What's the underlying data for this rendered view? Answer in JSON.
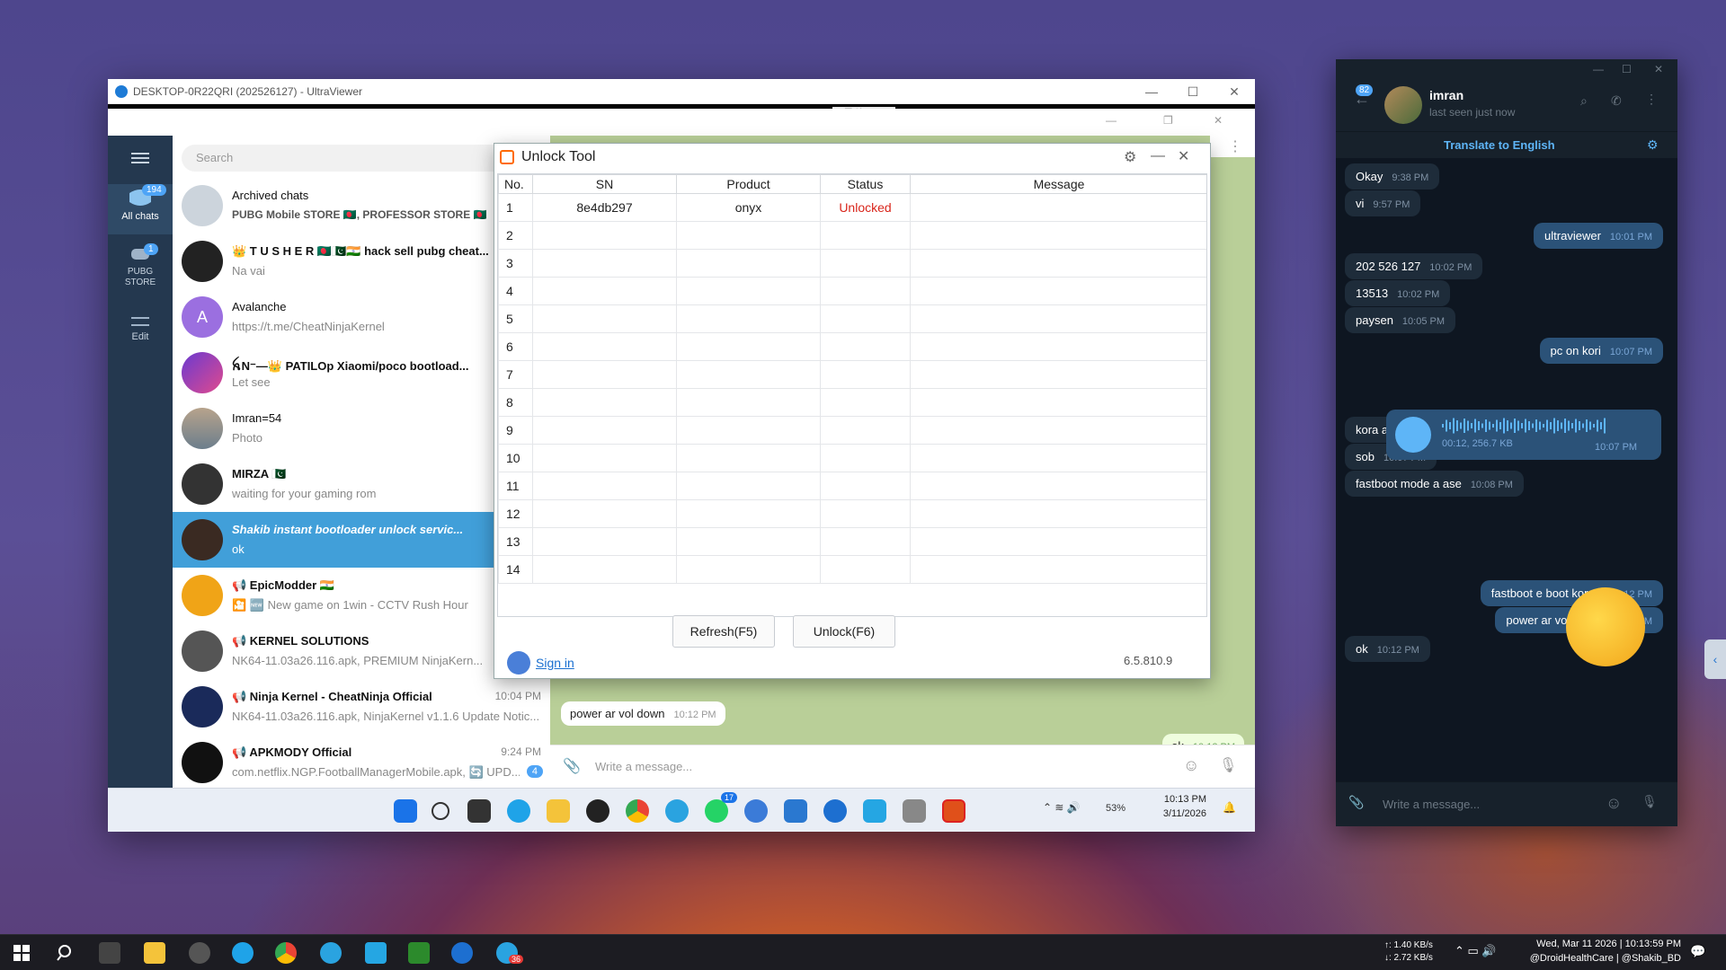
{
  "ultraviewer": {
    "title": "DESKTOP-0R22QRI (202526127) - UltraViewer"
  },
  "telegram_left": {
    "search_placeholder": "Search",
    "rail": [
      {
        "label": "All chats",
        "badge": "194"
      },
      {
        "label": "PUBG STORE",
        "badge": "1"
      },
      {
        "label": "Edit"
      }
    ],
    "chats": [
      {
        "name": "Archived chats",
        "preview": "PUBG Mobile STORE 🇧🇩, PROFESSOR STORE 🇧🇩",
        "time": ""
      },
      {
        "name": "👑 T U S H E R 🇧🇩🇵🇰🇮🇳 hack sell pubg cheat...",
        "preview": "Na vai",
        "time": ""
      },
      {
        "name": "Avalanche",
        "preview": "https://t.me/CheatNinjaKernel",
        "time": ""
      },
      {
        "name": "ꫝN⁻—👑 PATILOp Xiaomi/poco bootload...",
        "preview": "Let see",
        "time": ""
      },
      {
        "name": "Imran=54",
        "preview": "Photo",
        "time": ""
      },
      {
        "name": "MIRZA 🇵🇰",
        "preview": "waiting for your gaming rom",
        "time": ""
      },
      {
        "name": "Shakib instant bootloader unlock servic...",
        "preview": "ok",
        "time": ""
      },
      {
        "name": "📢 EpicModder 🇮🇳",
        "preview": "🎦 🆕 New game on 1win - CCTV Rush Hour",
        "time": ""
      },
      {
        "name": "📢 KERNEL SOLUTIONS",
        "preview": "NK64-11.03a26.116.apk, PREMIUM NinjaKern...",
        "time": ""
      },
      {
        "name": "📢 Ninja Kernel - CheatNinja Official",
        "preview": "NK64-11.03a26.116.apk, NinjaKernel v1.1.6 Update Notic...",
        "time": "10:04 PM"
      },
      {
        "name": "📢 APKMODY Official",
        "preview": "com.netflix.NGP.FootballManagerMobile.apk, 🔄 UPD...",
        "time": "9:24 PM",
        "badge": "4"
      }
    ],
    "chat_msgs": [
      {
        "text": "power ar vol down",
        "time": "10:12 PM"
      },
      {
        "text": "ok",
        "time": "10:12 PM"
      }
    ],
    "composer_placeholder": "Write a message..."
  },
  "unlock_tool": {
    "title": "Unlock Tool",
    "columns": [
      "No.",
      "SN",
      "Product",
      "Status",
      "Message"
    ],
    "rows": [
      {
        "no": "1",
        "sn": "8e4db297",
        "product": "onyx",
        "status": "Unlocked",
        "message": ""
      },
      {
        "no": "2"
      },
      {
        "no": "3"
      },
      {
        "no": "4"
      },
      {
        "no": "5"
      },
      {
        "no": "6"
      },
      {
        "no": "7"
      },
      {
        "no": "8"
      },
      {
        "no": "9"
      },
      {
        "no": "10"
      },
      {
        "no": "11"
      },
      {
        "no": "12"
      },
      {
        "no": "13"
      },
      {
        "no": "14"
      }
    ],
    "refresh_label": "Refresh(F5)",
    "unlock_label": "Unlock(F6)",
    "sign_in_label": "Sign in",
    "version": "6.5.810.9",
    "status_color": "#d9261c"
  },
  "remote_taskbar": {
    "time": "10:13 PM",
    "date": "3/11/2026",
    "battery": "53%",
    "badge_a": "17"
  },
  "telegram_right": {
    "back_badge": "82",
    "contact_name": "imran",
    "contact_status": "last seen just now",
    "translate_label": "Translate to English",
    "voice": {
      "meta": "00:12, 256.7 KB",
      "time": "10:07 PM",
      "progress": 0.0
    },
    "messages": [
      {
        "dir": "in",
        "text": "Okay",
        "time": "9:38 PM"
      },
      {
        "dir": "in",
        "text": "vi",
        "time": "9:57 PM"
      },
      {
        "dir": "out",
        "text": "ultraviewer",
        "time": "10:01 PM"
      },
      {
        "dir": "in",
        "text": "202 526 127",
        "time": "10:02 PM"
      },
      {
        "dir": "in",
        "text": "13513",
        "time": "10:02 PM"
      },
      {
        "dir": "in",
        "text": "paysen",
        "time": "10:05 PM"
      },
      {
        "dir": "out",
        "text": "pc on kori",
        "time": "10:07 PM"
      },
      {
        "dir": "in",
        "text": "kora ase",
        "time": "10:07 PM"
      },
      {
        "dir": "in",
        "text": "sob",
        "time": "10:07 PM"
      },
      {
        "dir": "in",
        "text": "fastboot mode a ase",
        "time": "10:08 PM"
      },
      {
        "dir": "out",
        "text": "fastboot e boot koren",
        "time": "10:12 PM"
      },
      {
        "dir": "out",
        "text": "power ar vol down",
        "time": "10:12 PM"
      },
      {
        "dir": "in",
        "text": "ok",
        "time": "10:12 PM"
      }
    ],
    "composer_placeholder": "Write a message..."
  },
  "host_taskbar": {
    "net_up": "↑: 1.40 KB/s",
    "net_down": "↓: 2.72 KB/s",
    "datetime": "Wed, Mar 11 2026 | 10:13:59 PM",
    "credits": "@DroidHealthCare | @Shakib_BD",
    "tg_badge": "36"
  },
  "colors": {
    "telegram_blue": "#419fd9",
    "dark_bg": "#17212b",
    "out_bubble": "#2b5278"
  }
}
